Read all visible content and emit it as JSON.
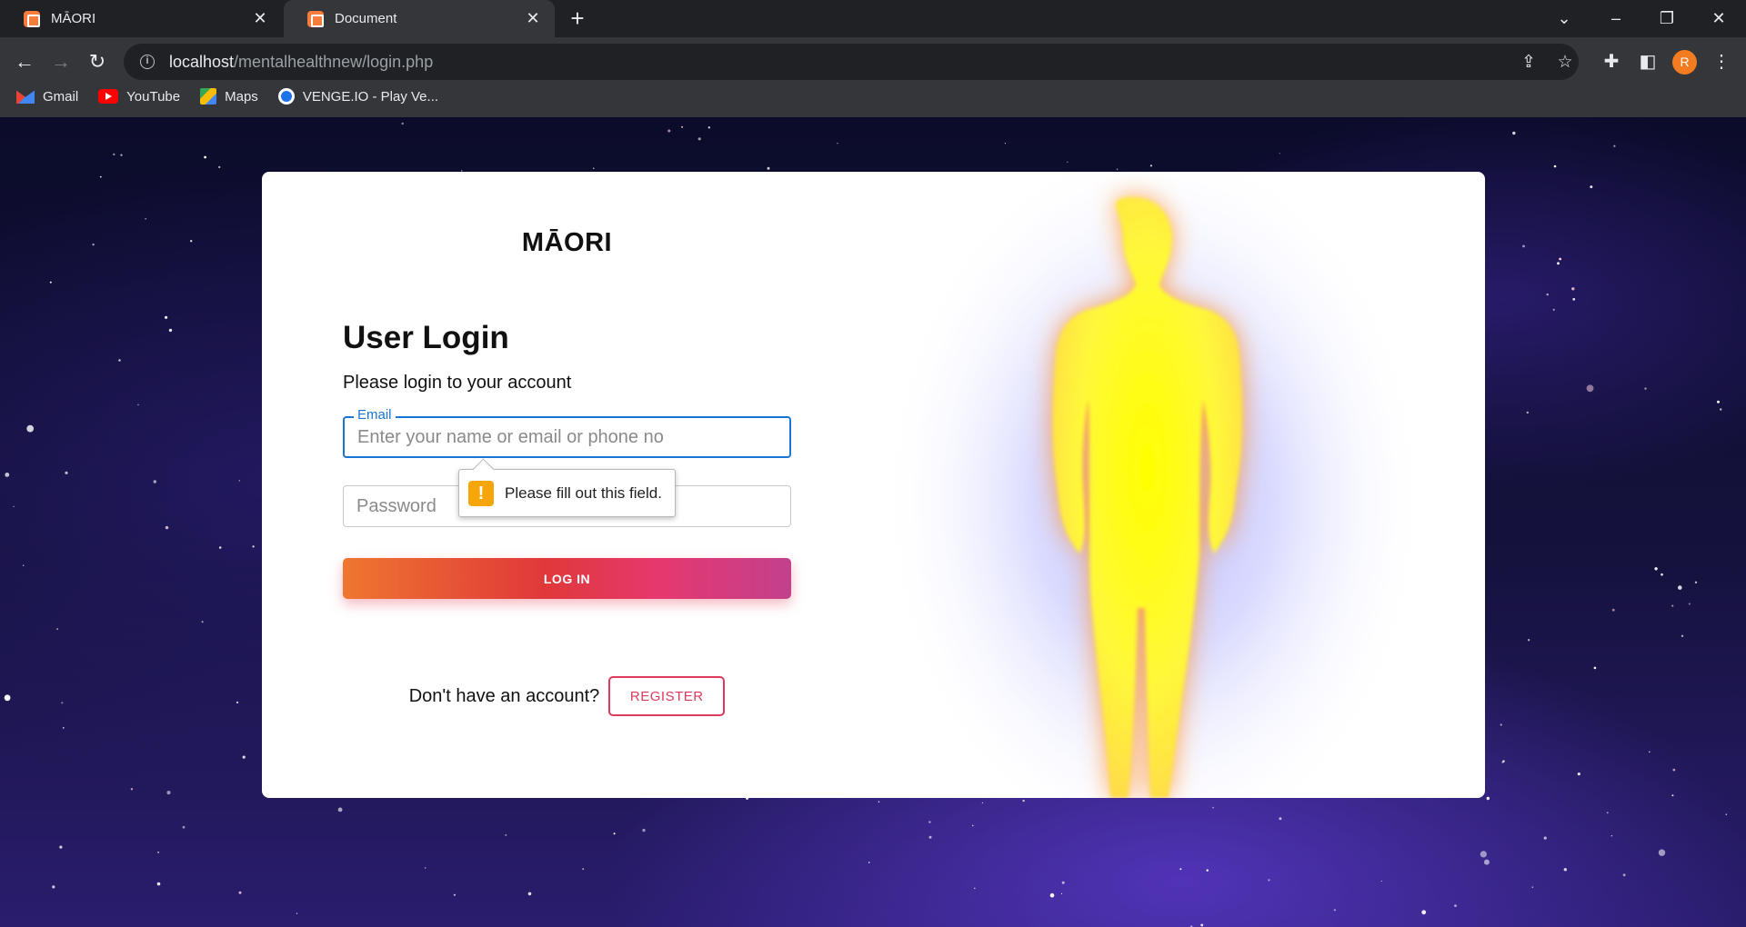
{
  "browser": {
    "tabs": [
      {
        "title": "MĀORI",
        "active": false
      },
      {
        "title": "Document",
        "active": true
      }
    ],
    "url_host": "localhost",
    "url_path": "/mentalhealthnew/login.php",
    "profile_initial": "R",
    "bookmarks": [
      {
        "label": "Gmail",
        "icon": "gmail-icon"
      },
      {
        "label": "YouTube",
        "icon": "youtube-icon"
      },
      {
        "label": "Maps",
        "icon": "maps-icon"
      },
      {
        "label": "VENGE.IO - Play Ve...",
        "icon": "venge-icon"
      }
    ]
  },
  "page": {
    "logo": "MĀORI",
    "title": "User Login",
    "subtitle": "Please login to your account",
    "email_label": "Email",
    "email_placeholder": "Enter your name or email or phone no",
    "password_placeholder": "Password",
    "validation_message": "Please fill out this field.",
    "login_button": "LOG IN",
    "register_prompt": "Don't have an account?",
    "register_button": "REGISTER"
  },
  "colors": {
    "accent": "#1976d2",
    "register": "#dd3a5b",
    "gradient_start": "#ee7630",
    "gradient_end": "#c2418c",
    "warning": "#f6a609"
  }
}
